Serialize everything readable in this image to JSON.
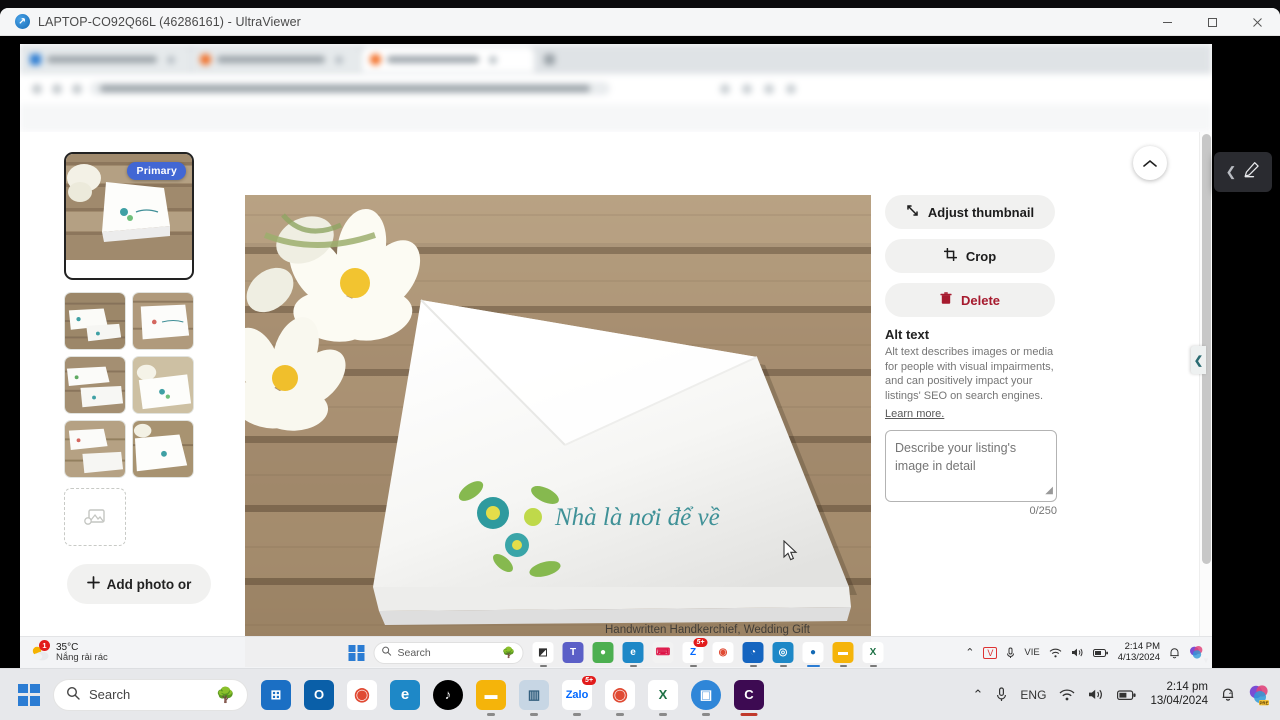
{
  "window": {
    "title": "LAPTOP-CO92Q66L (46286161) - UltraViewer",
    "app_icon": "ultraviewer-icon",
    "minimize": "—",
    "maximize": "□",
    "close": "✕"
  },
  "listing_page": {
    "collapse_icon": "chevron-up-icon",
    "primary_badge": "Primary",
    "add_photo_label": "Add photo or",
    "add_photo_icon": "plus-icon",
    "thumb_placeholder_icon": "image-placeholder-icon",
    "photo_alt_text": "Nhà là nơi để về",
    "background_listing_title": "Handwritten Handkerchief, Wedding Gift",
    "side_tab_icon": "chevron-left-icon",
    "scroll_down_icon": "caret-down-icon"
  },
  "right_panel": {
    "buttons": [
      {
        "label": "Adjust thumbnail",
        "icon": "expand-arrows-icon",
        "style": "default"
      },
      {
        "label": "Crop",
        "icon": "crop-icon",
        "style": "default"
      },
      {
        "label": "Delete",
        "icon": "trash-icon",
        "style": "danger"
      }
    ],
    "alt_text_heading": "Alt text",
    "alt_text_description": "Alt text describes images or media for people with visual impairments, and can positively impact your listings' SEO on search engines.",
    "learn_more_label": "Learn more.",
    "alt_text_placeholder": "Describe your listing's image in detail",
    "alt_text_value": "",
    "char_counter": "0/250",
    "accent_delete_color": "#a61a2e"
  },
  "remote_taskbar": {
    "weather_temp": "35°C",
    "weather_desc": "Nắng rải rác",
    "weather_badge": "1",
    "weather_icon": "sun-cloud-icon",
    "start_icon": "windows-start-icon",
    "search_placeholder": "Search",
    "search_icon": "search-icon",
    "apps": [
      {
        "name": "widgets-icon",
        "glyph": "◧",
        "color": "#ffffff",
        "fg": "#2f2f2f",
        "active": false
      },
      {
        "name": "teams-icon",
        "glyph": "T",
        "color": "#5b5fc7",
        "fg": "#ffffff",
        "active": false
      },
      {
        "name": "mail-icon",
        "glyph": "●",
        "color": "#4caf50",
        "fg": "#ffffff",
        "active": false
      },
      {
        "name": "edge-icon",
        "glyph": "e",
        "color": "#1e88c7",
        "fg": "#ffffff",
        "active": true
      },
      {
        "name": "keyboard-icon",
        "glyph": "⌨",
        "color": "#f2f2f2",
        "fg": "#d14",
        "active": false
      },
      {
        "name": "zalo-icon",
        "glyph": "Z",
        "color": "#ffffff",
        "fg": "#0068ff",
        "active": true,
        "badge": "5+"
      },
      {
        "name": "chrome-icon",
        "glyph": "◉",
        "color": "#ffffff",
        "fg": "#e04a33",
        "active": false
      },
      {
        "name": "clock-icon",
        "glyph": "◔",
        "color": "#1565c0",
        "fg": "#ffffff",
        "active": true
      },
      {
        "name": "safari-icon",
        "glyph": "◎",
        "color": "#1e88c7",
        "fg": "#ffffff",
        "active": true
      },
      {
        "name": "ultraviewer-icon",
        "glyph": "●",
        "color": "#ffffff",
        "fg": "#1369b4",
        "active": true
      },
      {
        "name": "file-explorer-icon",
        "glyph": "▬",
        "color": "#f5b40a",
        "fg": "#ffffff",
        "active": true
      },
      {
        "name": "excel-icon",
        "glyph": "X",
        "color": "#ffffff",
        "fg": "#1d7044",
        "active": true
      }
    ],
    "tray": {
      "overflow_icon": "chevron-up-icon",
      "vpn_icon": "v-shield-icon",
      "mic_icon": "microphone-icon",
      "language": "VIE",
      "wifi_icon": "wifi-icon",
      "volume_icon": "speaker-icon",
      "battery_icon": "battery-icon",
      "time": "2:14 PM",
      "date": "4/13/2024",
      "notification_icon": "bell-icon",
      "copilot_icon": "copilot-icon"
    }
  },
  "host_taskbar": {
    "start_icon": "windows-start-icon",
    "search_placeholder": "Search",
    "search_icon": "search-icon",
    "search_widget_icon": "tree-icon",
    "apps": [
      {
        "name": "microsoft-store-icon",
        "glyph": "⊞",
        "color": "#1b6fc4",
        "fg": "#ffffff",
        "active": false
      },
      {
        "name": "outlook-icon",
        "glyph": "O",
        "color": "#0a5fa8",
        "fg": "#ffffff",
        "active": false
      },
      {
        "name": "chrome-profile-icon",
        "glyph": "◉",
        "color": "#ffffff",
        "fg": "#e04a33",
        "active": false
      },
      {
        "name": "edge-icon",
        "glyph": "e",
        "color": "#1e88c7",
        "fg": "#ffffff",
        "active": false
      },
      {
        "name": "tiktok-icon",
        "glyph": "♪",
        "color": "#000000",
        "fg": "#ffffff",
        "active": false
      },
      {
        "name": "file-explorer-icon",
        "glyph": "▬",
        "color": "#f5b40a",
        "fg": "#ffffff",
        "active": true
      },
      {
        "name": "analytics-icon",
        "glyph": "░",
        "color": "#c7d6e4",
        "fg": "#34607f",
        "active": true
      },
      {
        "name": "zalo-icon",
        "glyph": "Z",
        "color": "#ffffff",
        "fg": "#0068ff",
        "active": true,
        "badge": "5+"
      },
      {
        "name": "chrome-icon",
        "glyph": "◉",
        "color": "#ffffff",
        "fg": "#e04a33",
        "active": true
      },
      {
        "name": "excel-icon",
        "glyph": "X",
        "color": "#ffffff",
        "fg": "#1d7044",
        "active": true
      },
      {
        "name": "ultraviewer-icon",
        "glyph": "▣",
        "color": "#2f86d8",
        "fg": "#ffffff",
        "active": true
      },
      {
        "name": "capcut-icon",
        "glyph": "C",
        "color": "#3d0a52",
        "fg": "#ffffff",
        "active": true,
        "focused": true
      }
    ],
    "tray": {
      "overflow_icon": "chevron-up-icon",
      "mic_icon": "microphone-icon",
      "language": "ENG",
      "wifi_icon": "wifi-icon",
      "volume_icon": "speaker-icon",
      "battery_icon": "battery-icon",
      "time": "2:14 pm",
      "date": "13/04/2024",
      "notification_icon": "bell-quiet-icon",
      "copilot_icon": "copilot-pre-icon"
    }
  },
  "floating_toolbar": {
    "collapse_icon": "chevron-left-icon",
    "edit_icon": "pencil-icon"
  }
}
